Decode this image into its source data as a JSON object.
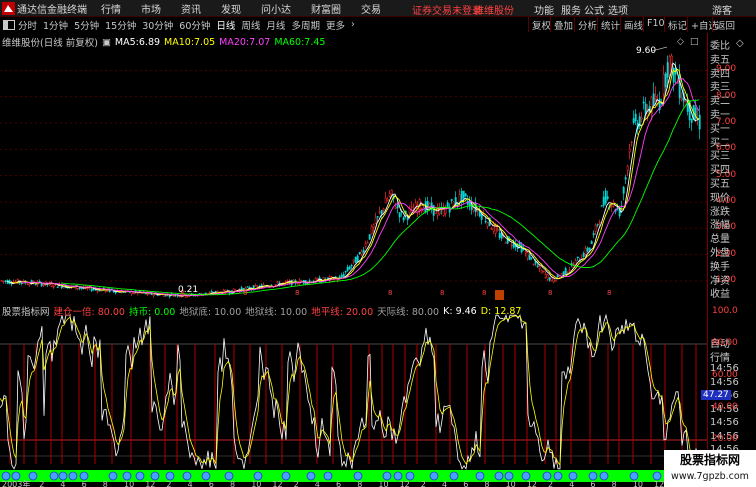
{
  "app": {
    "title": "通达信金融终端",
    "menu": [
      "行情",
      "市场",
      "资讯",
      "发现",
      "问小达",
      "财富圈",
      "交易"
    ],
    "warning": "证券交易未登录",
    "stock_name": "维维股份",
    "right_menu": [
      "功能",
      "服务",
      "公式",
      "选项"
    ],
    "user": "游客"
  },
  "periods": [
    "分时",
    "1分钟",
    "5分钟",
    "15分钟",
    "30分钟",
    "60分钟",
    "日线",
    "周线",
    "月线",
    "多周期",
    "更多"
  ],
  "active_period": "日线",
  "toolbar_right": [
    "复权",
    "叠加",
    "分析",
    "统计",
    "画线",
    "F10",
    "标记",
    "+自选",
    "返回"
  ],
  "main_chart": {
    "title": "维维股份(日线 前复权)",
    "ma": [
      {
        "label": "MA5:",
        "value": "6.89",
        "color": "#ffffff"
      },
      {
        "label": "MA10:",
        "value": "7.05",
        "color": "#ffff00"
      },
      {
        "label": "MA20:",
        "value": "7.07",
        "color": "#ff40ff"
      },
      {
        "label": "MA60:",
        "value": "7.45",
        "color": "#00ff00"
      }
    ],
    "high_label": "9.60",
    "low_label": "0.21",
    "y_ticks": [
      "9.00",
      "8.00",
      "7.00",
      "6.00",
      "5.00",
      "4.00",
      "3.00",
      "2.00",
      "1.00"
    ]
  },
  "indicator": {
    "name": "股票指标网",
    "items": [
      {
        "label": "建仓一倍:",
        "value": "80.00",
        "color": "#ff4040"
      },
      {
        "label": "持币:",
        "value": "0.00",
        "color": "#00ff00"
      },
      {
        "label": "地狱底:",
        "value": "10.00",
        "color": "#a0a0a0"
      },
      {
        "label": "地狱线:",
        "value": "10.00",
        "color": "#a0a0a0"
      },
      {
        "label": "地平线:",
        "value": "20.00",
        "color": "#ff4040"
      },
      {
        "label": "天际线:",
        "value": "80.00",
        "color": "#a0a0a0"
      },
      {
        "label": "K:",
        "value": "9.46",
        "color": "#ffffff"
      },
      {
        "label": "D:",
        "value": "12.87",
        "color": "#ffff00"
      }
    ],
    "y_ticks": [
      "100.0",
      "80.00",
      "60.00",
      "40.00",
      "20.00"
    ],
    "current": "47.27"
  },
  "right_panel": {
    "order_labels": [
      "委比",
      "卖五",
      "卖四",
      "卖三",
      "卖二",
      "卖一",
      "买一",
      "买二",
      "买三",
      "买四",
      "买五",
      "现价",
      "涨跌",
      "涨幅",
      "总量",
      "外盘",
      "换手",
      "净资",
      "收益"
    ],
    "auto_labels": [
      "自动",
      "行情"
    ],
    "times": [
      "14:56",
      "14:56",
      "14:56",
      "14:56",
      "14:56",
      "14:56",
      "14:56",
      "14:56",
      "14:56",
      "14:56",
      "14:56"
    ]
  },
  "x_axis": [
    "2003年",
    "2",
    "4",
    "6",
    "8",
    "10",
    "12",
    "2",
    "4",
    "6",
    "8",
    "10",
    "12",
    "2",
    "4",
    "6",
    "8",
    "10",
    "12",
    "2",
    "4",
    "6",
    "8",
    "10",
    "12",
    "2",
    "4",
    "6",
    "8",
    "10",
    "12",
    "2",
    "4"
  ],
  "branding": {
    "big": "股票指标网",
    "url": "www.7gpzb.com"
  }
}
